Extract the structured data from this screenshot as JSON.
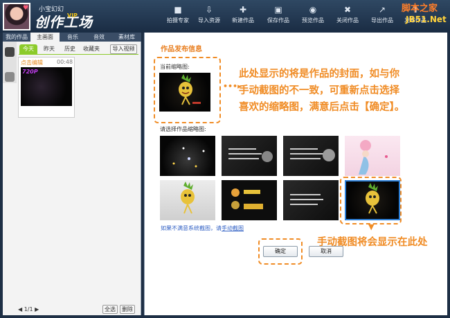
{
  "header": {
    "username": "小宝幻幻",
    "brand": "创作工场",
    "vip": "VIP",
    "toolbar": [
      {
        "label": "拍摄专家",
        "icon": "camera-icon"
      },
      {
        "label": "导入资源",
        "icon": "import-icon"
      },
      {
        "label": "新建作品",
        "icon": "new-icon"
      },
      {
        "label": "保存作品",
        "icon": "save-icon"
      },
      {
        "label": "预览作品",
        "icon": "eye-icon"
      },
      {
        "label": "关闭作品",
        "icon": "close-icon"
      },
      {
        "label": "导出作品",
        "icon": "export-icon"
      },
      {
        "label": "发布作品",
        "icon": "publish-icon"
      }
    ]
  },
  "watermark": {
    "line1": "脚本之家",
    "line2": "JB51.Net"
  },
  "left": {
    "tabs": [
      "我的作品",
      "主画面",
      "音乐",
      "音效",
      "素材库"
    ],
    "date_tabs": [
      "今天",
      "昨天",
      "历史",
      "收藏夹"
    ],
    "import_btn": "导入视频",
    "card": {
      "title": "点击编辑",
      "duration": "00:48",
      "tag": "720P"
    },
    "pager": "◀ 1/1 ▶",
    "select_all": "全选",
    "delete": "删除"
  },
  "main": {
    "section_title": "作品发布信息",
    "current_label": "当前缩略图:",
    "select_label": "请选择作品缩略图:",
    "note1_lines": [
      "此处显示的将是作品的封面，如与你",
      "手动截图的不一致，可重新点击选择",
      "喜欢的缩略图，满意后点击【确定】。"
    ],
    "note2": "手动截图将会显示在此处",
    "manual_prefix": "如果不满意系统截图，请",
    "manual_link": "手动截图",
    "ok": "确定",
    "cancel": "取消"
  },
  "colors": {
    "accent": "#f08c25",
    "header": "#243a55",
    "tab_green": "#8ccb2a",
    "link": "#3362c5"
  }
}
